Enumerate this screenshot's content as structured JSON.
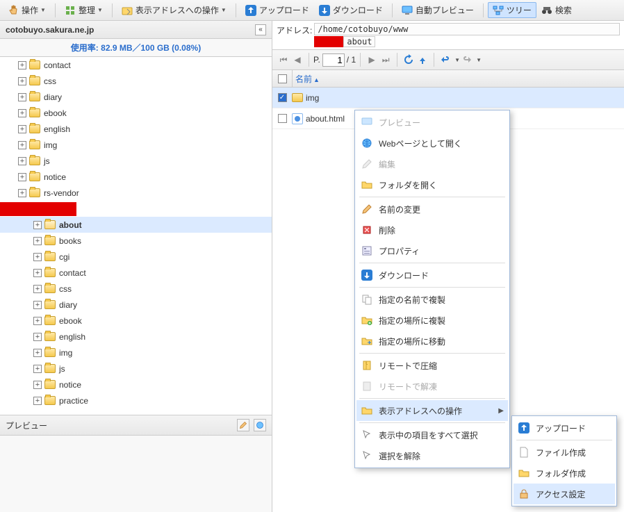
{
  "toolbar": {
    "operate": "操作",
    "organize": "整理",
    "display_addr_op": "表示アドレスへの操作",
    "upload": "アップロード",
    "download": "ダウンロード",
    "auto_preview": "自動プレビュー",
    "tree": "ツリー",
    "search": "検索"
  },
  "sidebar": {
    "host": "cotobuyo.sakura.ne.jp",
    "usage_label": "使用率: ",
    "usage_value": "82.9 MB／100 GB (0.08%)",
    "tree": [
      {
        "label": "contact",
        "level": 0
      },
      {
        "label": "css",
        "level": 0
      },
      {
        "label": "diary",
        "level": 0
      },
      {
        "label": "ebook",
        "level": 0
      },
      {
        "label": "english",
        "level": 0
      },
      {
        "label": "img",
        "level": 0
      },
      {
        "label": "js",
        "level": 0
      },
      {
        "label": "notice",
        "level": 0
      },
      {
        "label": "rs-vendor",
        "level": 0
      },
      {
        "label": "",
        "level": 0,
        "red": true
      },
      {
        "label": "about",
        "level": 1,
        "selected": true,
        "bold": true
      },
      {
        "label": "books",
        "level": 1
      },
      {
        "label": "cgi",
        "level": 1
      },
      {
        "label": "contact",
        "level": 1
      },
      {
        "label": "css",
        "level": 1
      },
      {
        "label": "diary",
        "level": 1
      },
      {
        "label": "ebook",
        "level": 1
      },
      {
        "label": "english",
        "level": 1
      },
      {
        "label": "img",
        "level": 1
      },
      {
        "label": "js",
        "level": 1
      },
      {
        "label": "notice",
        "level": 1
      },
      {
        "label": "practice",
        "level": 1
      }
    ],
    "preview_label": "プレビュー"
  },
  "address": {
    "label": "アドレス:",
    "path": "/home/cotobuyo/www",
    "sub": "about"
  },
  "pager": {
    "p_label": "P.",
    "current": "1",
    "total": "/ 1"
  },
  "list": {
    "name_col": "名前",
    "rows": [
      {
        "name": "img",
        "type": "folder",
        "checked": true
      },
      {
        "name": "about.html",
        "type": "html",
        "checked": false
      }
    ]
  },
  "ctx": {
    "preview": "プレビュー",
    "open_web": "Webページとして開く",
    "edit": "編集",
    "open_folder": "フォルダを開く",
    "rename": "名前の変更",
    "delete": "削除",
    "property": "プロパティ",
    "download": "ダウンロード",
    "dup_name": "指定の名前で複製",
    "dup_place": "指定の場所に複製",
    "move_place": "指定の場所に移動",
    "compress": "リモートで圧縮",
    "decompress": "リモートで解凍",
    "disp_addr_op": "表示アドレスへの操作",
    "select_all": "表示中の項目をすべて選択",
    "deselect": "選択を解除"
  },
  "submenu": {
    "upload": "アップロード",
    "file_create": "ファイル作成",
    "folder_create": "フォルダ作成",
    "access": "アクセス設定"
  }
}
